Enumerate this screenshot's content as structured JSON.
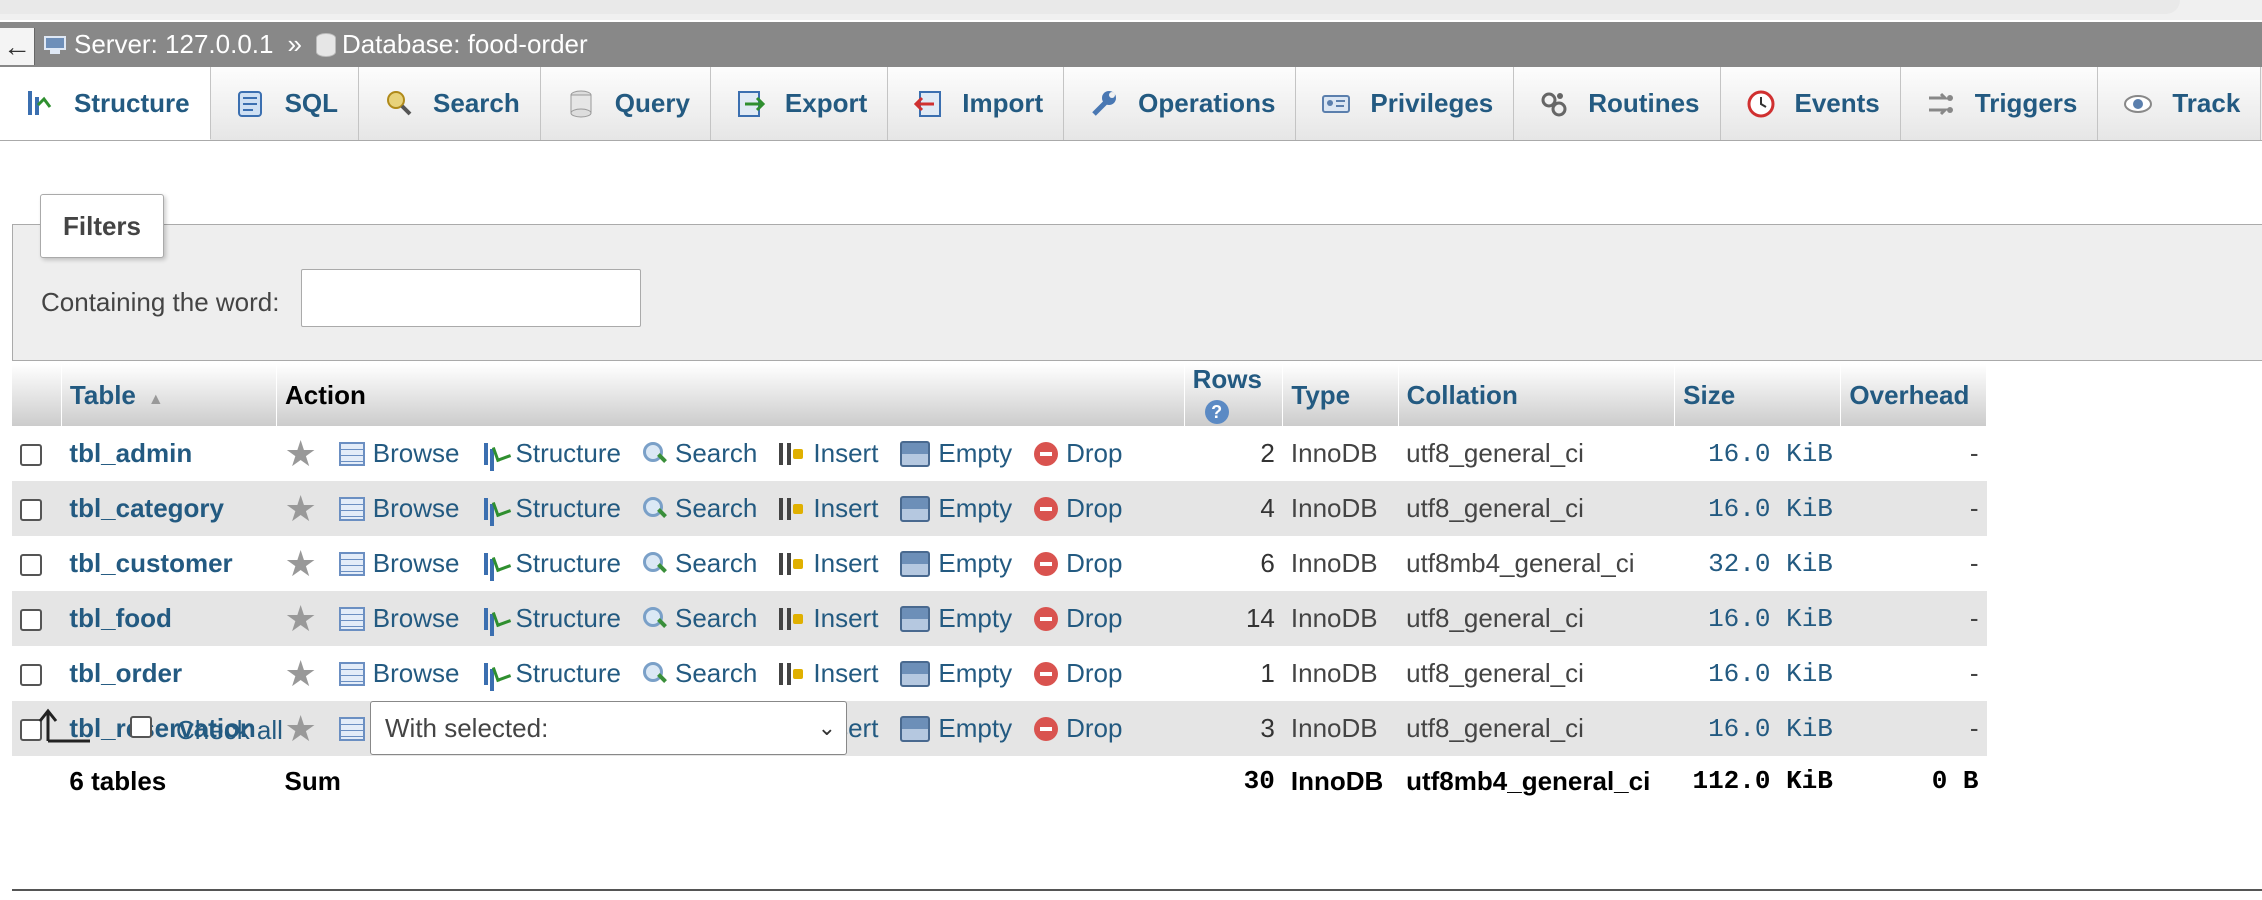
{
  "nav": {
    "back_glyph": "←"
  },
  "breadcrumb": {
    "server": "Server: 127.0.0.1",
    "separator": "»",
    "database": "Database: food-order"
  },
  "tabs": [
    {
      "label": "Structure",
      "icon": "structure-icon",
      "active": true
    },
    {
      "label": "SQL",
      "icon": "sql-icon"
    },
    {
      "label": "Search",
      "icon": "search-icon"
    },
    {
      "label": "Query",
      "icon": "query-icon"
    },
    {
      "label": "Export",
      "icon": "export-icon"
    },
    {
      "label": "Import",
      "icon": "import-icon"
    },
    {
      "label": "Operations",
      "icon": "wrench-icon"
    },
    {
      "label": "Privileges",
      "icon": "privileges-icon"
    },
    {
      "label": "Routines",
      "icon": "routines-icon"
    },
    {
      "label": "Events",
      "icon": "clock-icon"
    },
    {
      "label": "Triggers",
      "icon": "triggers-icon"
    },
    {
      "label": "Track",
      "icon": "eye-icon"
    }
  ],
  "filters": {
    "legend": "Filters",
    "label": "Containing the word:",
    "value": ""
  },
  "table": {
    "headers": {
      "table": "Table",
      "action": "Action",
      "rows": "Rows",
      "type": "Type",
      "collation": "Collation",
      "size": "Size",
      "overhead": "Overhead"
    },
    "actions": {
      "browse": "Browse",
      "structure": "Structure",
      "search": "Search",
      "insert": "Insert",
      "empty": "Empty",
      "drop": "Drop"
    },
    "rows": [
      {
        "name": "tbl_admin",
        "rows": "2",
        "type": "InnoDB",
        "collation": "utf8_general_ci",
        "size": "16.0 KiB",
        "overhead": "-"
      },
      {
        "name": "tbl_category",
        "rows": "4",
        "type": "InnoDB",
        "collation": "utf8_general_ci",
        "size": "16.0 KiB",
        "overhead": "-"
      },
      {
        "name": "tbl_customer",
        "rows": "6",
        "type": "InnoDB",
        "collation": "utf8mb4_general_ci",
        "size": "32.0 KiB",
        "overhead": "-"
      },
      {
        "name": "tbl_food",
        "rows": "14",
        "type": "InnoDB",
        "collation": "utf8_general_ci",
        "size": "16.0 KiB",
        "overhead": "-"
      },
      {
        "name": "tbl_order",
        "rows": "1",
        "type": "InnoDB",
        "collation": "utf8_general_ci",
        "size": "16.0 KiB",
        "overhead": "-"
      },
      {
        "name": "tbl_reservation",
        "rows": "3",
        "type": "InnoDB",
        "collation": "utf8_general_ci",
        "size": "16.0 KiB",
        "overhead": "-"
      }
    ],
    "summary": {
      "tables": "6 tables",
      "label": "Sum",
      "rows": "30",
      "type": "InnoDB",
      "collation": "utf8mb4_general_ci",
      "size": "112.0 KiB",
      "overhead": "0 B"
    }
  },
  "bottom": {
    "check_all": "Check all",
    "with_selected": "With selected:"
  },
  "colors": {
    "link": "#235a81",
    "header_bar": "#888888",
    "row_alt": "#e5e5e5",
    "drop": "#d9534f"
  }
}
